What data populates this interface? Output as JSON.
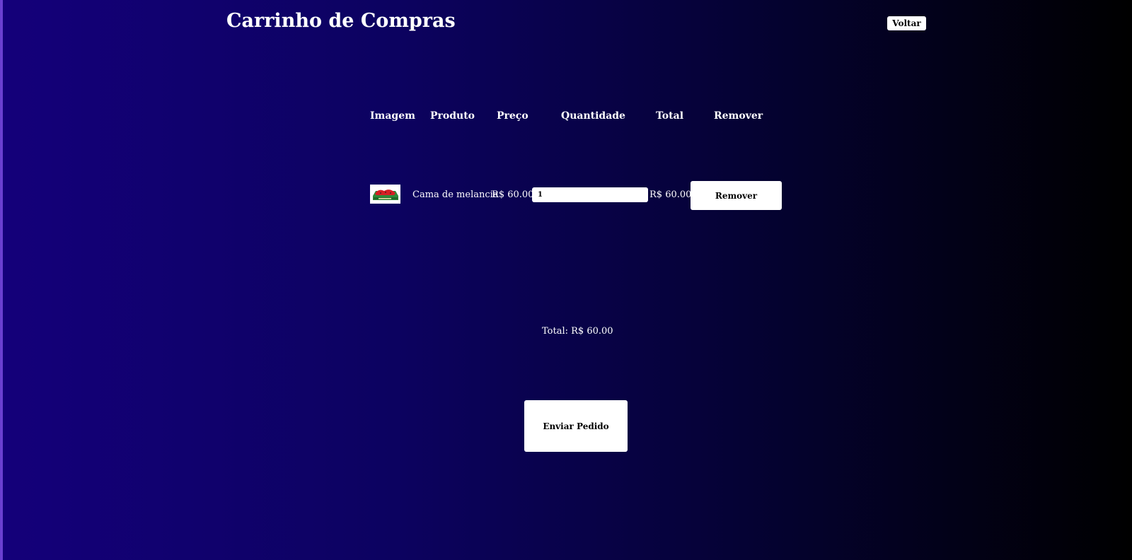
{
  "header": {
    "title": "Carrinho de Compras",
    "back_label": "Voltar"
  },
  "table": {
    "headers": [
      "Imagem",
      "Produto",
      "Preço",
      "Quantidade",
      "Total",
      "Remover"
    ],
    "rows": [
      {
        "image_icon": "watermelon-bed-image",
        "product": "Cama de melancia",
        "price": "R$ 60.00",
        "quantity": "1",
        "total": "R$ 60.00",
        "remove_label": "Remover"
      }
    ]
  },
  "summary": {
    "total_text": "Total: R$ 60.00"
  },
  "actions": {
    "submit_label": "Enviar Pedido"
  },
  "colors": {
    "background_start": "#14007a",
    "background_end": "#000000",
    "button_bg": "#ffffff",
    "text": "#ffffff"
  }
}
